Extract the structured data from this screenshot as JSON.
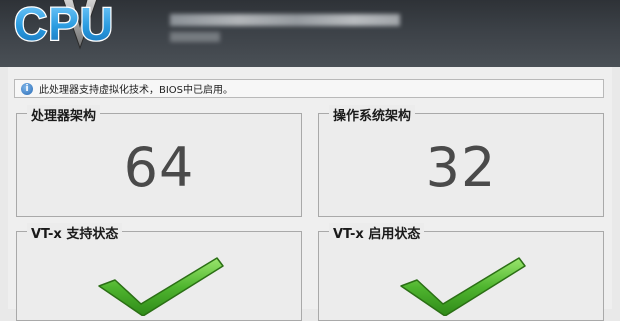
{
  "header": {
    "logo_text": "CPU"
  },
  "info": {
    "icon": "info-icon",
    "text": "此处理器支持虚拟化技术，BIOS中已启用。"
  },
  "panels": [
    {
      "title": "处理器架构",
      "value": "64"
    },
    {
      "title": "操作系统架构",
      "value": "32"
    },
    {
      "title": "VT-x 支持状态",
      "icon": "checkmark-icon"
    },
    {
      "title": "VT-x 启用状态",
      "icon": "checkmark-icon"
    }
  ],
  "colors": {
    "header_bg": "#3c4147",
    "logo_fill": "#2e9be0",
    "check_green": "#4fb52f",
    "number_gray": "#4a4a4a"
  }
}
